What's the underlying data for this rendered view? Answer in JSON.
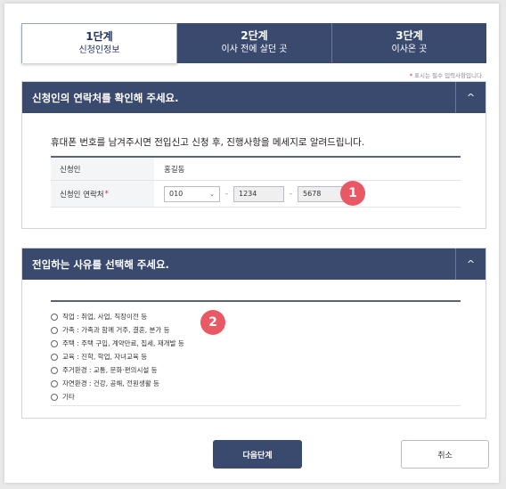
{
  "steps": [
    {
      "num": "1단계",
      "label": "신청인정보"
    },
    {
      "num": "2단계",
      "label": "이사 전에 살던 곳"
    },
    {
      "num": "3단계",
      "label": "이사온 곳"
    }
  ],
  "required_note": {
    "star": "*",
    "text": " 표시는 필수 입력사항입니다."
  },
  "contact_section": {
    "title": "신청인의 연락처를 확인해 주세요.",
    "collapse_icon": "^",
    "description": "휴대폰 번호를 남겨주시면 전입신고 신청 후, 진행사항을 메세지로 알려드립니다.",
    "applicant_label": "신청인",
    "applicant_name": "홍길동",
    "phone_label": "신청인 연락처",
    "phone_star": "*",
    "phone_prefix": "010",
    "phone_middle": "1234",
    "phone_last": "5678",
    "dash": "-",
    "badge": "1"
  },
  "reason_section": {
    "title": "전입하는 사유를 선택해 주세요.",
    "collapse_icon": "^",
    "badge": "2",
    "options": [
      "직업 : 취업, 사업, 직장이전 등",
      "가족 : 가족과 함께 거주, 결혼, 분가 등",
      "주택 : 주택 구입, 계약만료, 집세, 재개발 등",
      "교육 : 진학, 학업, 자녀교육 등",
      "주거환경 : 교통, 문화·편의시설 등",
      "자연환경 : 건강, 공해, 전원생활 등",
      "기타"
    ]
  },
  "buttons": {
    "next": "다음단계",
    "cancel": "취소"
  },
  "colors": {
    "primary": "#3a4a6e",
    "badge": "#e85865",
    "required": "#d3293a"
  }
}
